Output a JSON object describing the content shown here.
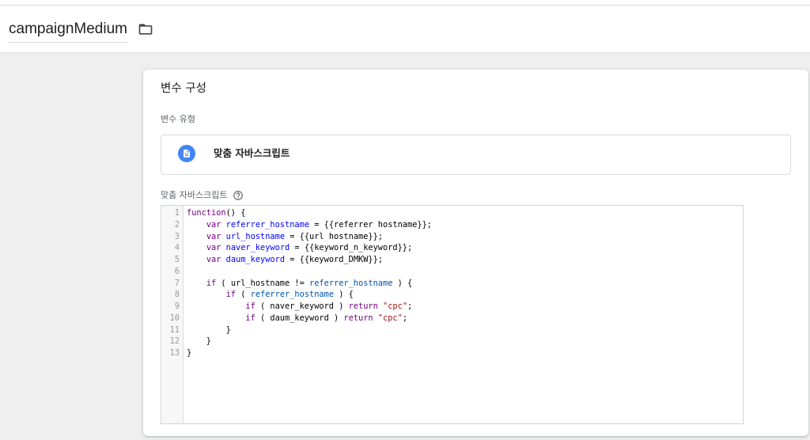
{
  "header": {
    "title": "campaignMedium"
  },
  "config": {
    "title": "변수 구성",
    "type_label": "변수 유형",
    "type_value": "맞춤 자바스크립트",
    "code_label": "맞춤 자바스크립트"
  },
  "icons": {
    "folder": "folder-icon",
    "type": "document-icon",
    "help": "help-icon"
  },
  "colors": {
    "background": "#efefef",
    "accent": "#4285f4",
    "keyword": "#770088",
    "definition": "#0000ff",
    "variable": "#0055aa",
    "string": "#aa1111"
  },
  "editor": {
    "lines": [
      {
        "n": "1",
        "tokens": [
          {
            "text": "function",
            "color": "#770088"
          },
          {
            "text": "() {"
          }
        ]
      },
      {
        "n": "2",
        "tokens": [
          {
            "text": "    "
          },
          {
            "text": "var",
            "color": "#770088"
          },
          {
            "text": " "
          },
          {
            "text": "referrer_hostname",
            "color": "#0000ff"
          },
          {
            "text": " = {{referrer hostname}};"
          }
        ]
      },
      {
        "n": "3",
        "tokens": [
          {
            "text": "    "
          },
          {
            "text": "var",
            "color": "#770088"
          },
          {
            "text": " "
          },
          {
            "text": "url_hostname",
            "color": "#0000ff"
          },
          {
            "text": " = {{url hostname}};"
          }
        ]
      },
      {
        "n": "4",
        "tokens": [
          {
            "text": "    "
          },
          {
            "text": "var",
            "color": "#770088"
          },
          {
            "text": " "
          },
          {
            "text": "naver_keyword",
            "color": "#0000ff"
          },
          {
            "text": " = {{keyword_n_keyword}};"
          }
        ]
      },
      {
        "n": "5",
        "tokens": [
          {
            "text": "    "
          },
          {
            "text": "var",
            "color": "#770088"
          },
          {
            "text": " "
          },
          {
            "text": "daum_keyword",
            "color": "#0000ff"
          },
          {
            "text": " = {{keyword_DMKW}};"
          }
        ]
      },
      {
        "n": "6",
        "tokens": []
      },
      {
        "n": "7",
        "tokens": [
          {
            "text": "    "
          },
          {
            "text": "if",
            "color": "#770088"
          },
          {
            "text": " ( url_hostname != "
          },
          {
            "text": "referrer_hostname",
            "color": "#0055aa"
          },
          {
            "text": " ) {"
          }
        ]
      },
      {
        "n": "8",
        "tokens": [
          {
            "text": "        "
          },
          {
            "text": "if",
            "color": "#770088"
          },
          {
            "text": " ( "
          },
          {
            "text": "referrer_hostname",
            "color": "#0055aa"
          },
          {
            "text": " ) {"
          }
        ]
      },
      {
        "n": "9",
        "tokens": [
          {
            "text": "            "
          },
          {
            "text": "if",
            "color": "#770088"
          },
          {
            "text": " ( naver_keyword ) "
          },
          {
            "text": "return",
            "color": "#770088"
          },
          {
            "text": " "
          },
          {
            "text": "\"cpc\"",
            "color": "#aa1111"
          },
          {
            "text": ";"
          }
        ]
      },
      {
        "n": "10",
        "tokens": [
          {
            "text": "            "
          },
          {
            "text": "if",
            "color": "#770088"
          },
          {
            "text": " ( daum_keyword ) "
          },
          {
            "text": "return",
            "color": "#770088"
          },
          {
            "text": " "
          },
          {
            "text": "\"cpc\"",
            "color": "#aa1111"
          },
          {
            "text": ";"
          }
        ]
      },
      {
        "n": "11",
        "tokens": [
          {
            "text": "        }"
          }
        ]
      },
      {
        "n": "12",
        "tokens": [
          {
            "text": "    }"
          }
        ]
      },
      {
        "n": "13",
        "tokens": [
          {
            "text": "}"
          }
        ]
      }
    ]
  }
}
